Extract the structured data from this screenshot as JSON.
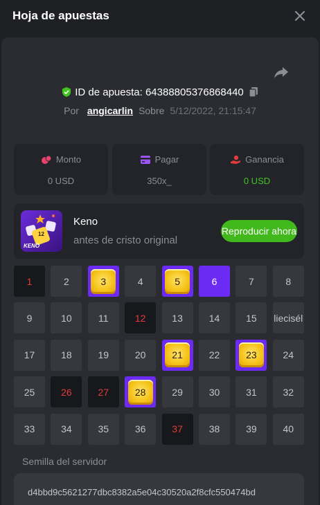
{
  "header": {
    "title": "Hoja de apuestas"
  },
  "bet": {
    "id_label": "ID de apuesta:",
    "id_value": "64388805376868440",
    "by_label": "Por",
    "user": "angicarlin",
    "on_label": "Sobre",
    "date": "5/12/2022, 21:15:47"
  },
  "stats": [
    {
      "label": "Monto",
      "value": "0 USD",
      "icon": "coins-icon",
      "icon_color": "#e8436e"
    },
    {
      "label": "Pagar",
      "value": "350x_",
      "icon": "card-icon",
      "icon_color": "#9b57f5"
    },
    {
      "label": "Ganancia",
      "value": "0 USD",
      "icon": "hand-coin-icon",
      "icon_color": "#e23b3b"
    }
  ],
  "game": {
    "name": "Keno",
    "subtitle": "antes de cristo original",
    "play_label": "Reproducir ahora",
    "thumb_text": "KENO",
    "thumb_badge": "12"
  },
  "keno_grid": [
    {
      "n": "1",
      "state": "miss"
    },
    {
      "n": "2",
      "state": "none"
    },
    {
      "n": "3",
      "state": "hit"
    },
    {
      "n": "4",
      "state": "none"
    },
    {
      "n": "5",
      "state": "hit"
    },
    {
      "n": "6",
      "state": "sel"
    },
    {
      "n": "7",
      "state": "none"
    },
    {
      "n": "8",
      "state": "none"
    },
    {
      "n": "9",
      "state": "none"
    },
    {
      "n": "10",
      "state": "none"
    },
    {
      "n": "11",
      "state": "none"
    },
    {
      "n": "12",
      "state": "miss"
    },
    {
      "n": "13",
      "state": "none"
    },
    {
      "n": "14",
      "state": "none"
    },
    {
      "n": "15",
      "state": "none"
    },
    {
      "n": "liecisél",
      "state": "none"
    },
    {
      "n": "17",
      "state": "none"
    },
    {
      "n": "18",
      "state": "none"
    },
    {
      "n": "19",
      "state": "none"
    },
    {
      "n": "20",
      "state": "none"
    },
    {
      "n": "21",
      "state": "hit"
    },
    {
      "n": "22",
      "state": "none"
    },
    {
      "n": "23",
      "state": "hit"
    },
    {
      "n": "24",
      "state": "none"
    },
    {
      "n": "25",
      "state": "none"
    },
    {
      "n": "26",
      "state": "miss"
    },
    {
      "n": "27",
      "state": "miss"
    },
    {
      "n": "28",
      "state": "hit"
    },
    {
      "n": "29",
      "state": "none"
    },
    {
      "n": "30",
      "state": "none"
    },
    {
      "n": "31",
      "state": "none"
    },
    {
      "n": "32",
      "state": "none"
    },
    {
      "n": "33",
      "state": "none"
    },
    {
      "n": "34",
      "state": "none"
    },
    {
      "n": "35",
      "state": "none"
    },
    {
      "n": "36",
      "state": "none"
    },
    {
      "n": "37",
      "state": "miss"
    },
    {
      "n": "38",
      "state": "none"
    },
    {
      "n": "39",
      "state": "none"
    },
    {
      "n": "40",
      "state": "none"
    }
  ],
  "seed": {
    "label": "Semilla del servidor",
    "value": "d4bbd9c5621277dbc8382a5e04c30520a2f8cfc550474bd"
  },
  "colors": {
    "accent_purple": "#6c2bf2",
    "play_green": "#41b81c",
    "miss_red": "#e23b3b",
    "win_green": "#41c51e"
  }
}
